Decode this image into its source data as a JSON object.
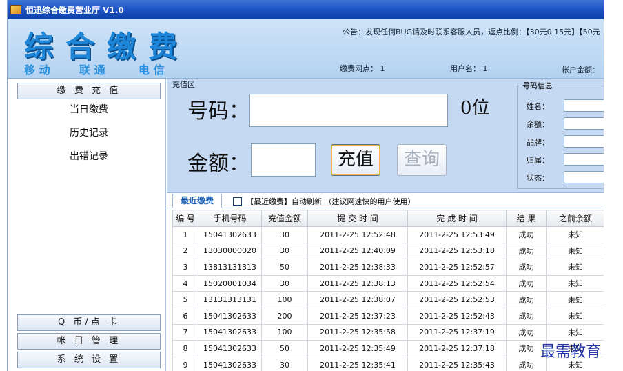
{
  "window": {
    "title": "恒迅综合缴费营业厅 V1.0"
  },
  "banner": {
    "logo_main": "综合缴费",
    "logo_sub": [
      "移 动",
      "联 通",
      "电 信"
    ],
    "notice": "公告：发现任何BUG请及时联系客服人员，返点比例：【30元0.15元】【50元",
    "outlet_label": "缴费网点：",
    "outlet_value": "1",
    "username_label": "用户名：",
    "username_value": "1",
    "balance_label": "帐户金额："
  },
  "nav": {
    "section_recharge": "缴 费 充 值",
    "items": [
      "当日缴费",
      "历史记录",
      "出错记录"
    ],
    "section_qcoin": "Q 币/点 卡",
    "section_account": "帐 目 管 理",
    "section_settings": "系 统 设 置"
  },
  "recharge": {
    "legend": "充值区",
    "number_label": "号码：",
    "number_value": "",
    "digit_count": "0位",
    "amount_label": "金额：",
    "amount_value": "",
    "recharge_button": "充值",
    "query_button": "查询"
  },
  "number_info": {
    "legend": "号码信息",
    "fields": [
      {
        "label": "姓名：",
        "value": ""
      },
      {
        "label": "余额：",
        "value": ""
      },
      {
        "label": "品牌：",
        "value": ""
      },
      {
        "label": "归属：",
        "value": ""
      },
      {
        "label": "状态：",
        "value": ""
      }
    ]
  },
  "recent": {
    "tab_label": "最近缴费",
    "auto_refresh_label": "【最近缴费】自动刷新 （建议网速快的用户使用）",
    "auto_refresh_checked": false,
    "columns": [
      "编 号",
      "手机号码",
      "充值金额",
      "提 交 时 间",
      "完 成 时 间",
      "结 果",
      "之前余额"
    ],
    "rows": [
      [
        "1",
        "15041302633",
        "30",
        "2011-2-25 12:52:48",
        "2011-2-25 12:53:49",
        "成功",
        "未知"
      ],
      [
        "2",
        "13030000020",
        "30",
        "2011-2-25 12:40:09",
        "2011-2-25 12:53:18",
        "成功",
        "未知"
      ],
      [
        "3",
        "13813131313",
        "50",
        "2011-2-25 12:38:33",
        "2011-2-25 12:52:57",
        "成功",
        "未知"
      ],
      [
        "4",
        "15020001034",
        "30",
        "2011-2-25 12:38:13",
        "2011-2-25 12:52:54",
        "成功",
        "未知"
      ],
      [
        "5",
        "13131313131",
        "100",
        "2011-2-25 12:38:07",
        "2011-2-25 12:52:53",
        "成功",
        "未知"
      ],
      [
        "6",
        "15041302633",
        "200",
        "2011-2-25 12:37:23",
        "2011-2-25 12:52:43",
        "成功",
        "未知"
      ],
      [
        "7",
        "15041302633",
        "100",
        "2011-2-25 12:35:58",
        "2011-2-25 12:37:19",
        "成功",
        "未知"
      ],
      [
        "8",
        "15041302633",
        "50",
        "2011-2-25 12:35:49",
        "2011-2-25 12:37:18",
        "成功",
        "未知"
      ],
      [
        "9",
        "15041302633",
        "30",
        "2011-2-25 12:35:41",
        "2011-2-25 12:35:43",
        "成功",
        "未知"
      ]
    ]
  },
  "watermark": "最需教育"
}
